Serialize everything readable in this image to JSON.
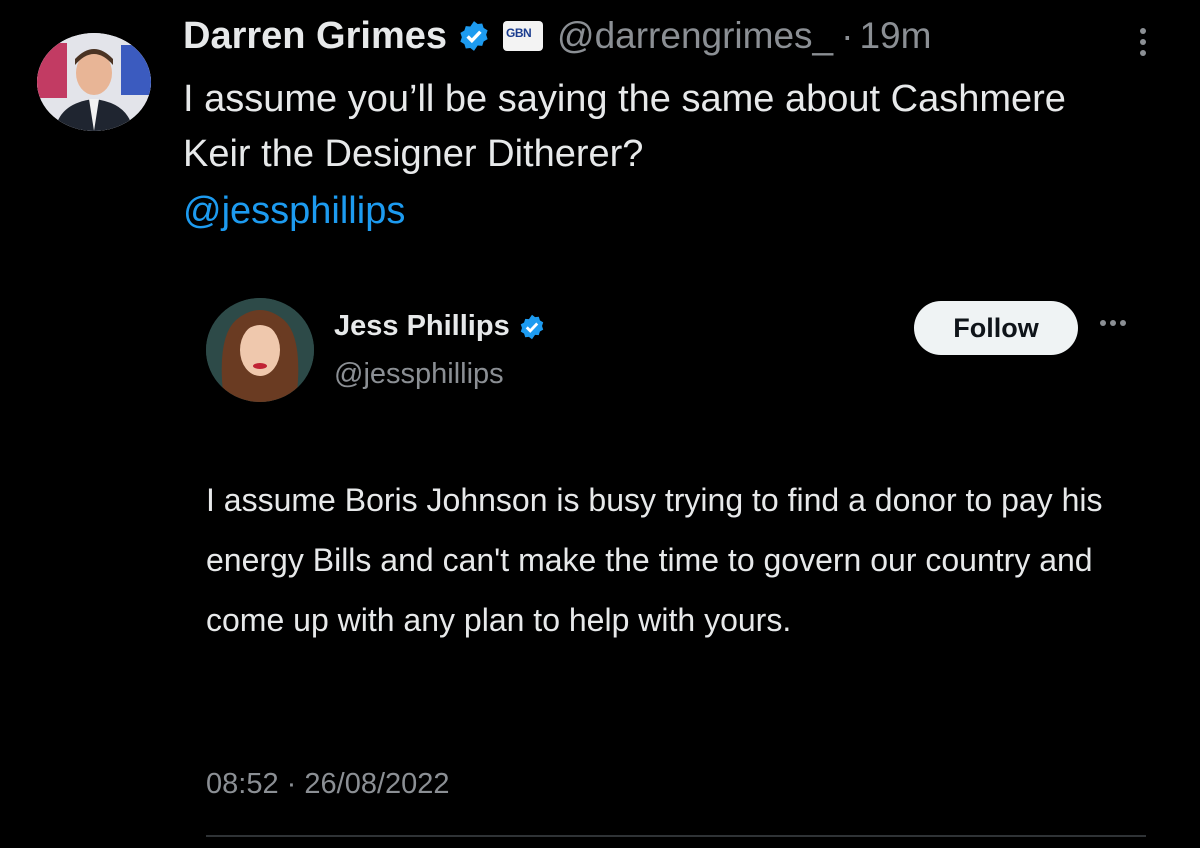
{
  "tweet": {
    "author_name": "Darren Grimes",
    "affiliation_badge": "GBN",
    "handle": "@darrengrimes_",
    "separator": "·",
    "time": "19m",
    "text": "I assume you’ll be saying the same about Cashmere Keir the Designer Ditherer?",
    "mention": "@jessphillips"
  },
  "quoted": {
    "author_name": "Jess Phillips",
    "handle": "@jessphillips",
    "follow_label": "Follow",
    "text": "I assume Boris Johnson is busy trying to find a donor to pay his energy Bills and can't make the time to govern our country and come up with any plan to help with yours.",
    "time": "08:52",
    "separator": "·",
    "date": "26/08/2022"
  },
  "colors": {
    "background": "#000000",
    "text": "#e7e9ea",
    "secondary": "#8b8f94",
    "link": "#1d9bf0",
    "verified": "#1d9bf0"
  },
  "icons": [
    "verified-badge-icon",
    "more-vertical-icon",
    "more-horizontal-icon"
  ]
}
